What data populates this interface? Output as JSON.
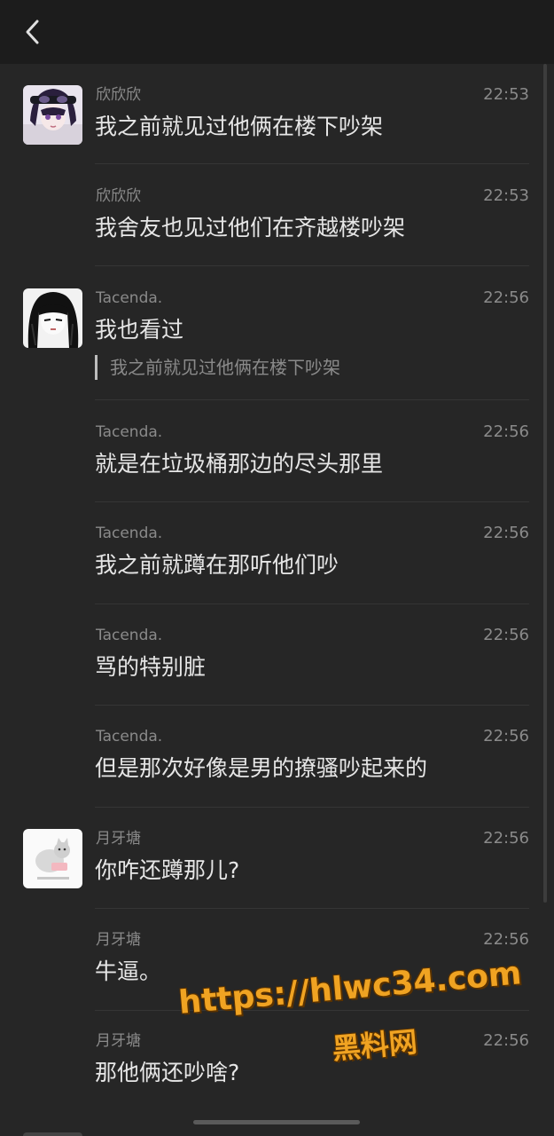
{
  "header": {
    "back_icon": "chevron-left-icon"
  },
  "messages": [
    {
      "name": "欣欣欣",
      "time": "22:53",
      "text": "我之前就见过他俩在楼下吵架",
      "avatar": "anime-girl-avatar"
    },
    {
      "name": "欣欣欣",
      "time": "22:53",
      "text": "我舍友也见过他们在齐越楼吵架"
    },
    {
      "name": "Tacenda.",
      "time": "22:56",
      "text": "我也看过",
      "quote": "我之前就见过他俩在楼下吵架",
      "avatar": "manga-girl-avatar"
    },
    {
      "name": "Tacenda.",
      "time": "22:56",
      "text": "就是在垃圾桶那边的尽头那里"
    },
    {
      "name": "Tacenda.",
      "time": "22:56",
      "text": "我之前就蹲在那听他们吵"
    },
    {
      "name": "Tacenda.",
      "time": "22:56",
      "text": "骂的特别脏"
    },
    {
      "name": "Tacenda.",
      "time": "22:56",
      "text": "但是那次好像是男的撩骚吵起来的"
    },
    {
      "name": "月牙塘",
      "time": "22:56",
      "text": "你咋还蹲那儿?",
      "avatar": "cat-sticker-avatar"
    },
    {
      "name": "月牙塘",
      "time": "22:56",
      "text": "牛逼。"
    },
    {
      "name": "月牙塘",
      "time": "22:56",
      "text": "那他俩还吵啥?"
    }
  ],
  "watermark": {
    "url": "https://hlwc34.com",
    "label": "黑料网"
  },
  "colors": {
    "background": "#262626",
    "topbar": "#1c1c1c",
    "meta_text": "#8a8a8a",
    "message_text": "#e6e6e6",
    "watermark": "#f0a322"
  }
}
